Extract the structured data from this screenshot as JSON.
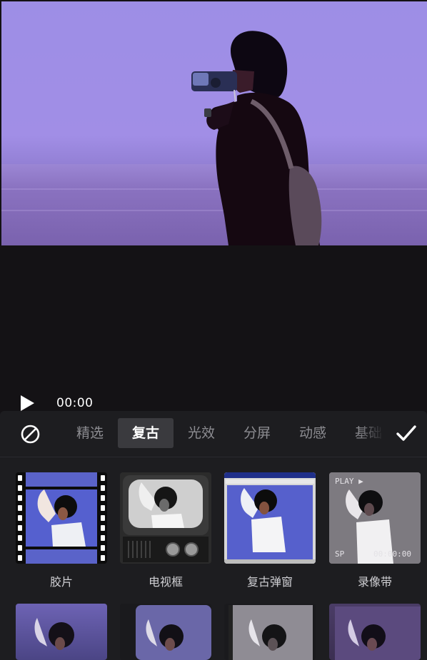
{
  "player": {
    "time": "00:00"
  },
  "tabs": [
    {
      "label": "精选",
      "active": false
    },
    {
      "label": "复古",
      "active": true
    },
    {
      "label": "光效",
      "active": false
    },
    {
      "label": "分屏",
      "active": false
    },
    {
      "label": "动感",
      "active": false
    },
    {
      "label": "基础",
      "active": false
    }
  ],
  "effects": [
    {
      "label": "胶片",
      "icon": "film-strip-thumbnail"
    },
    {
      "label": "电视框",
      "icon": "tv-frame-thumbnail"
    },
    {
      "label": "复古弹窗",
      "icon": "retro-window-thumbnail"
    },
    {
      "label": "录像带",
      "icon": "vhs-tape-thumbnail"
    }
  ],
  "vhs_overlay": {
    "play_text": "PLAY ▶",
    "sp_text": "SP",
    "counter_text": "00:00:00"
  },
  "colors": {
    "accent_tab_bg": "#3a3a3e",
    "panel_bg": "#1d1d20",
    "stage_bg": "#141215",
    "preview_tint": "#9d8ee6"
  }
}
